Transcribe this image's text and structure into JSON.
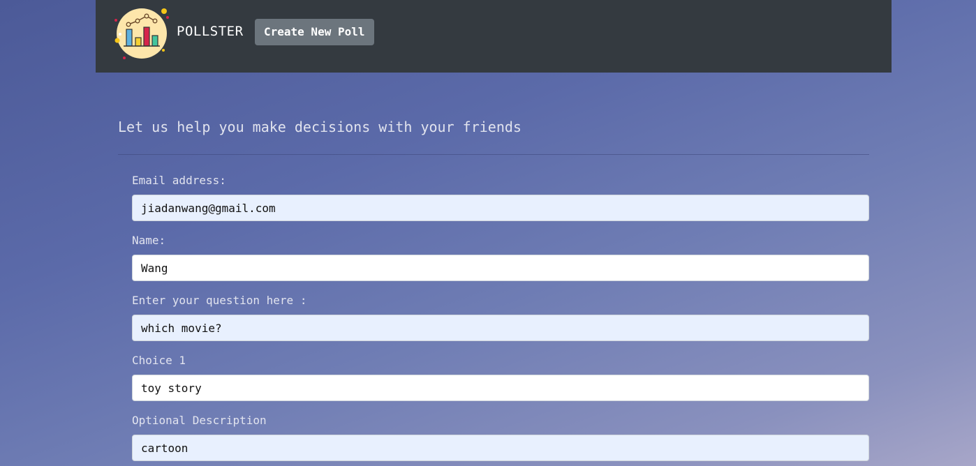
{
  "header": {
    "brand": "POLLSTER",
    "create_button": "Create New Poll"
  },
  "main": {
    "tagline": "Let us help you make decisions with your friends",
    "fields": [
      {
        "label": "Email address:",
        "value": "jiadanwang@gmail.com",
        "autofilled": true
      },
      {
        "label": "Name:",
        "value": "Wang",
        "autofilled": false
      },
      {
        "label": "Enter your question here :",
        "value": "which movie?",
        "autofilled": true
      },
      {
        "label": "Choice 1",
        "value": "toy story",
        "autofilled": false
      },
      {
        "label": "Optional Description",
        "value": "cartoon",
        "autofilled": true
      }
    ]
  },
  "colors": {
    "navbar": "#343a40",
    "button": "#6c757d",
    "autofill": "#e8f0fe"
  },
  "icons": {
    "logo": "bar-chart-logo-icon"
  }
}
